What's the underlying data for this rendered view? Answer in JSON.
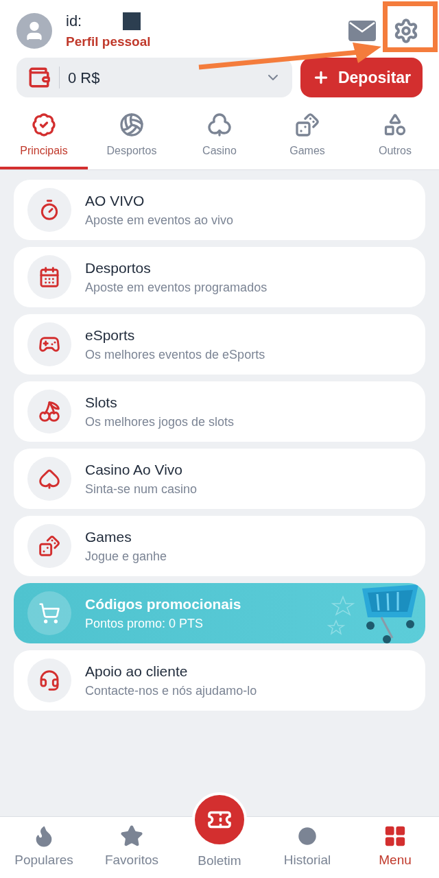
{
  "header": {
    "id_label": "id:",
    "profile_link": "Perfil pessoal"
  },
  "balance": {
    "amount": "0 R$"
  },
  "deposit_button": {
    "label": "Depositar"
  },
  "tabs": [
    {
      "label": "Principais",
      "selected": true
    },
    {
      "label": "Desportos",
      "selected": false
    },
    {
      "label": "Casino",
      "selected": false
    },
    {
      "label": "Games",
      "selected": false
    },
    {
      "label": "Outros",
      "selected": false
    }
  ],
  "menu_items": [
    {
      "kind": "plain",
      "title": "AO VIVO",
      "subtitle": "Aposte em eventos ao vivo"
    },
    {
      "kind": "plain",
      "title": "Desportos",
      "subtitle": "Aposte em eventos programados"
    },
    {
      "kind": "plain",
      "title": "eSports",
      "subtitle": "Os melhores eventos de eSports"
    },
    {
      "kind": "plain",
      "title": "Slots",
      "subtitle": "Os melhores jogos de slots"
    },
    {
      "kind": "plain",
      "title": "Casino Ao Vivo",
      "subtitle": "Sinta-se num casino"
    },
    {
      "kind": "plain",
      "title": "Games",
      "subtitle": "Jogue e ganhe"
    },
    {
      "kind": "promo",
      "title": "Códigos promocionais",
      "subtitle": "Pontos promo: 0 PTS"
    },
    {
      "kind": "plain",
      "title": "Apoio ao cliente",
      "subtitle": "Contacte-nos e nós ajudamo-lo"
    }
  ],
  "bottom_nav": [
    {
      "label": "Populares",
      "kind": "plain",
      "selected": false
    },
    {
      "label": "Favoritos",
      "kind": "plain",
      "selected": false
    },
    {
      "label": "Boletim",
      "kind": "center",
      "selected": false
    },
    {
      "label": "Historial",
      "kind": "plain",
      "selected": false
    },
    {
      "label": "Menu",
      "kind": "plain",
      "selected": true
    }
  ]
}
